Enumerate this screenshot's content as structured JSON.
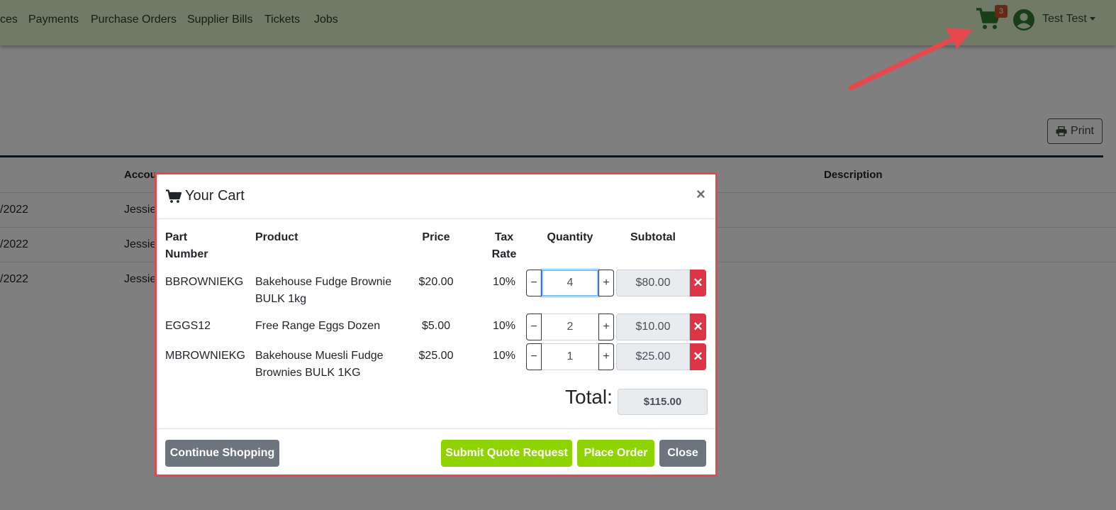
{
  "nav": {
    "links": [
      "ces",
      "Payments",
      "Purchase Orders",
      "Supplier Bills",
      "Tickets",
      "Jobs"
    ],
    "cart_count": "3",
    "user_name": "Test Test"
  },
  "page": {
    "print_label": "Print",
    "table_headers": [
      "Accou",
      "Description"
    ],
    "rows": [
      {
        "date": "/2022",
        "account": "Jessie"
      },
      {
        "date": "/2022",
        "account": "Jessie"
      },
      {
        "date": "/2022",
        "account": "Jessie"
      }
    ]
  },
  "cart": {
    "title": "Your Cart",
    "close_glyph": "×",
    "headers": {
      "part_number_1": "Part",
      "part_number_2": "Number",
      "product": "Product",
      "price": "Price",
      "tax_rate_1": "Tax",
      "tax_rate_2": "Rate",
      "quantity": "Quantity",
      "subtotal": "Subtotal"
    },
    "items": [
      {
        "part": "BBROWNIEKG",
        "product_1": "Bakehouse Fudge Brownie",
        "product_2": "BULK 1kg",
        "price": "$20.00",
        "tax": "10%",
        "qty": "4",
        "subtotal": "$80.00"
      },
      {
        "part": "EGGS12",
        "product_1": "Free Range Eggs Dozen",
        "product_2": "",
        "price": "$5.00",
        "tax": "10%",
        "qty": "2",
        "subtotal": "$10.00"
      },
      {
        "part": "MBROWNIEKG",
        "product_1": "Bakehouse Muesli Fudge",
        "product_2": "Brownies BULK 1KG",
        "price": "$25.00",
        "tax": "10%",
        "qty": "1",
        "subtotal": "$25.00"
      }
    ],
    "total_label": "Total:",
    "total_value": "$115.00",
    "buttons": {
      "continue": "Continue Shopping",
      "quote": "Submit Quote Request",
      "order": "Place Order",
      "close": "Close"
    }
  },
  "colors": {
    "nav_bg": "#e3f3cf",
    "accent_green": "#8fd400",
    "danger": "#dc3545",
    "annotation_red": "#e04a4e"
  }
}
